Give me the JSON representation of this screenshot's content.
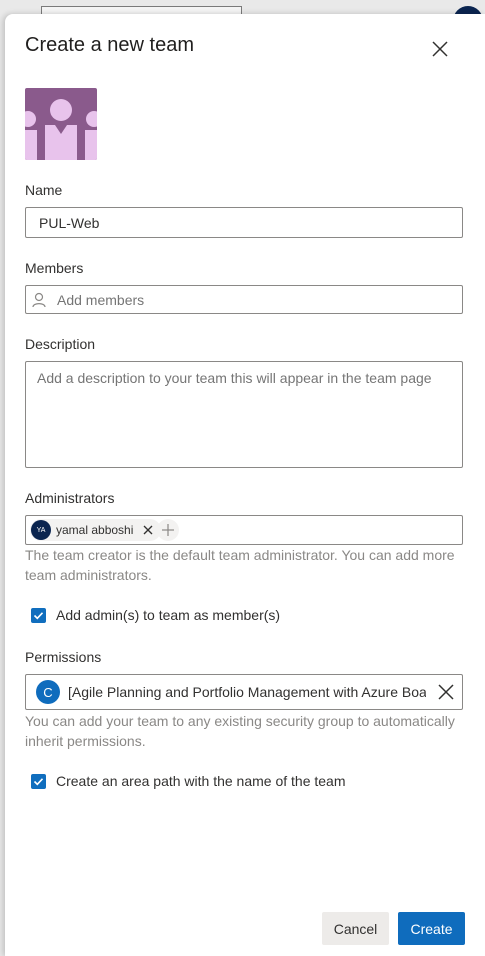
{
  "dialog": {
    "title": "Create a new team",
    "close_icon": "close-icon",
    "team_image_icon": "team-group-icon"
  },
  "name": {
    "label": "Name",
    "value": "PUL-Web"
  },
  "members": {
    "label": "Members",
    "placeholder": "Add members",
    "icon": "person-icon"
  },
  "description": {
    "label": "Description",
    "placeholder": "Add a description to your team this will appear in the team page"
  },
  "administrators": {
    "label": "Administrators",
    "chip": {
      "initials": "YA",
      "name": "yamal abboshi"
    },
    "helper": "The team creator is the default team administrator. You can add more team administrators."
  },
  "add_admins_checkbox": {
    "label": "Add admin(s) to team as member(s)",
    "checked": true
  },
  "permissions": {
    "label": "Permissions",
    "avatar_letter": "C",
    "value": "[Agile Planning and Portfolio Management with Azure Boa",
    "helper": "You can add your team to any existing security group to automatically inherit permissions."
  },
  "area_path_checkbox": {
    "label": "Create an area path with the name of the team",
    "checked": true
  },
  "buttons": {
    "cancel": "Cancel",
    "create": "Create"
  },
  "colors": {
    "accent": "#0F6CBD",
    "team_image_bg": "#8A5A8C",
    "team_image_fg": "#E8C3EC",
    "avatar_bg": "#0B2550"
  }
}
